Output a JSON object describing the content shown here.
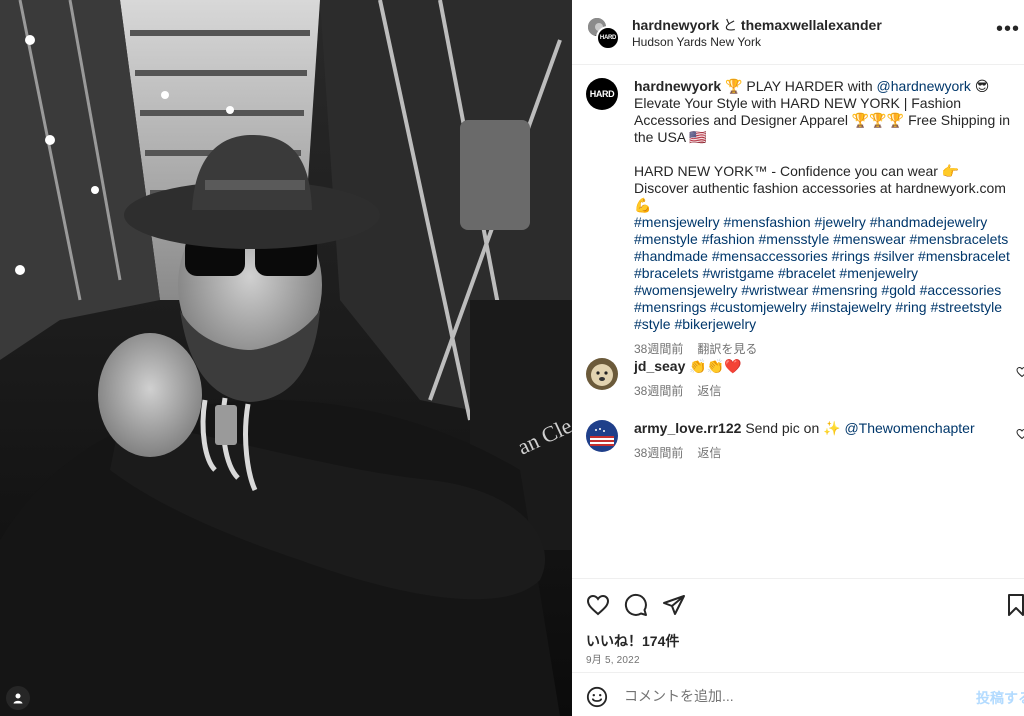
{
  "photo": {
    "alt": ""
  },
  "post": {
    "header": {
      "account1": "hardnewyork",
      "conjunction": "と",
      "account2": "themaxwellalexander",
      "location": "Hudson Yards New York",
      "avatar_text": "HARD"
    },
    "caption": {
      "username": "hardnewyork",
      "line1_pre": "🏆 PLAY HARDER with ",
      "mention": "@hardnewyork",
      "line1_post": " 😎 Elevate Your Style with HARD NEW YORK | Fashion Accessories and Designer Apparel 🏆🏆🏆 Free Shipping in the USA 🇺🇸",
      "paragraph2": "HARD NEW YORK™ - Confidence you can wear 👉 Discover authentic fashion accessories at hardnewyork.com 💪",
      "hashtags": "#mensjewelry #mensfashion #jewelry #handmadejewelry #menstyle #fashion #mensstyle #menswear #mensbracelets #handmade #mensaccessories #rings #silver #mensbracelet #bracelets #wristgame #bracelet #menjewelry #womensjewelry #wristwear #mensring #gold #accessories #mensrings #customjewelry #instajewelry #ring #streetstyle #style #bikerjewelry",
      "time": "38週間前",
      "translate": "翻訳を見る"
    },
    "comments": [
      {
        "username": "jd_seay",
        "text": "👏👏❤️",
        "mention": "",
        "time": "38週間前",
        "reply": "返信"
      },
      {
        "username": "army_love.rr122",
        "text": "Send pic on ✨ ",
        "mention": "@Thewomenchapter",
        "time": "38週間前",
        "reply": "返信"
      }
    ],
    "likes": "いいね！174件",
    "date": "9月 5, 2022",
    "comment_input": {
      "placeholder": "コメントを追加...",
      "value": ""
    },
    "post_button": "投稿する"
  },
  "icons": {
    "more": "more-horizontal-icon",
    "like": "heart-icon",
    "comment": "comment-icon",
    "share": "paper-plane-icon",
    "save": "bookmark-icon",
    "emoji": "smiley-icon",
    "user_tag": "user-tag-icon"
  },
  "colors": {
    "link": "#00376b",
    "muted": "#737373",
    "post_button": "#b3dbff",
    "heart_red": "#ed4956"
  }
}
